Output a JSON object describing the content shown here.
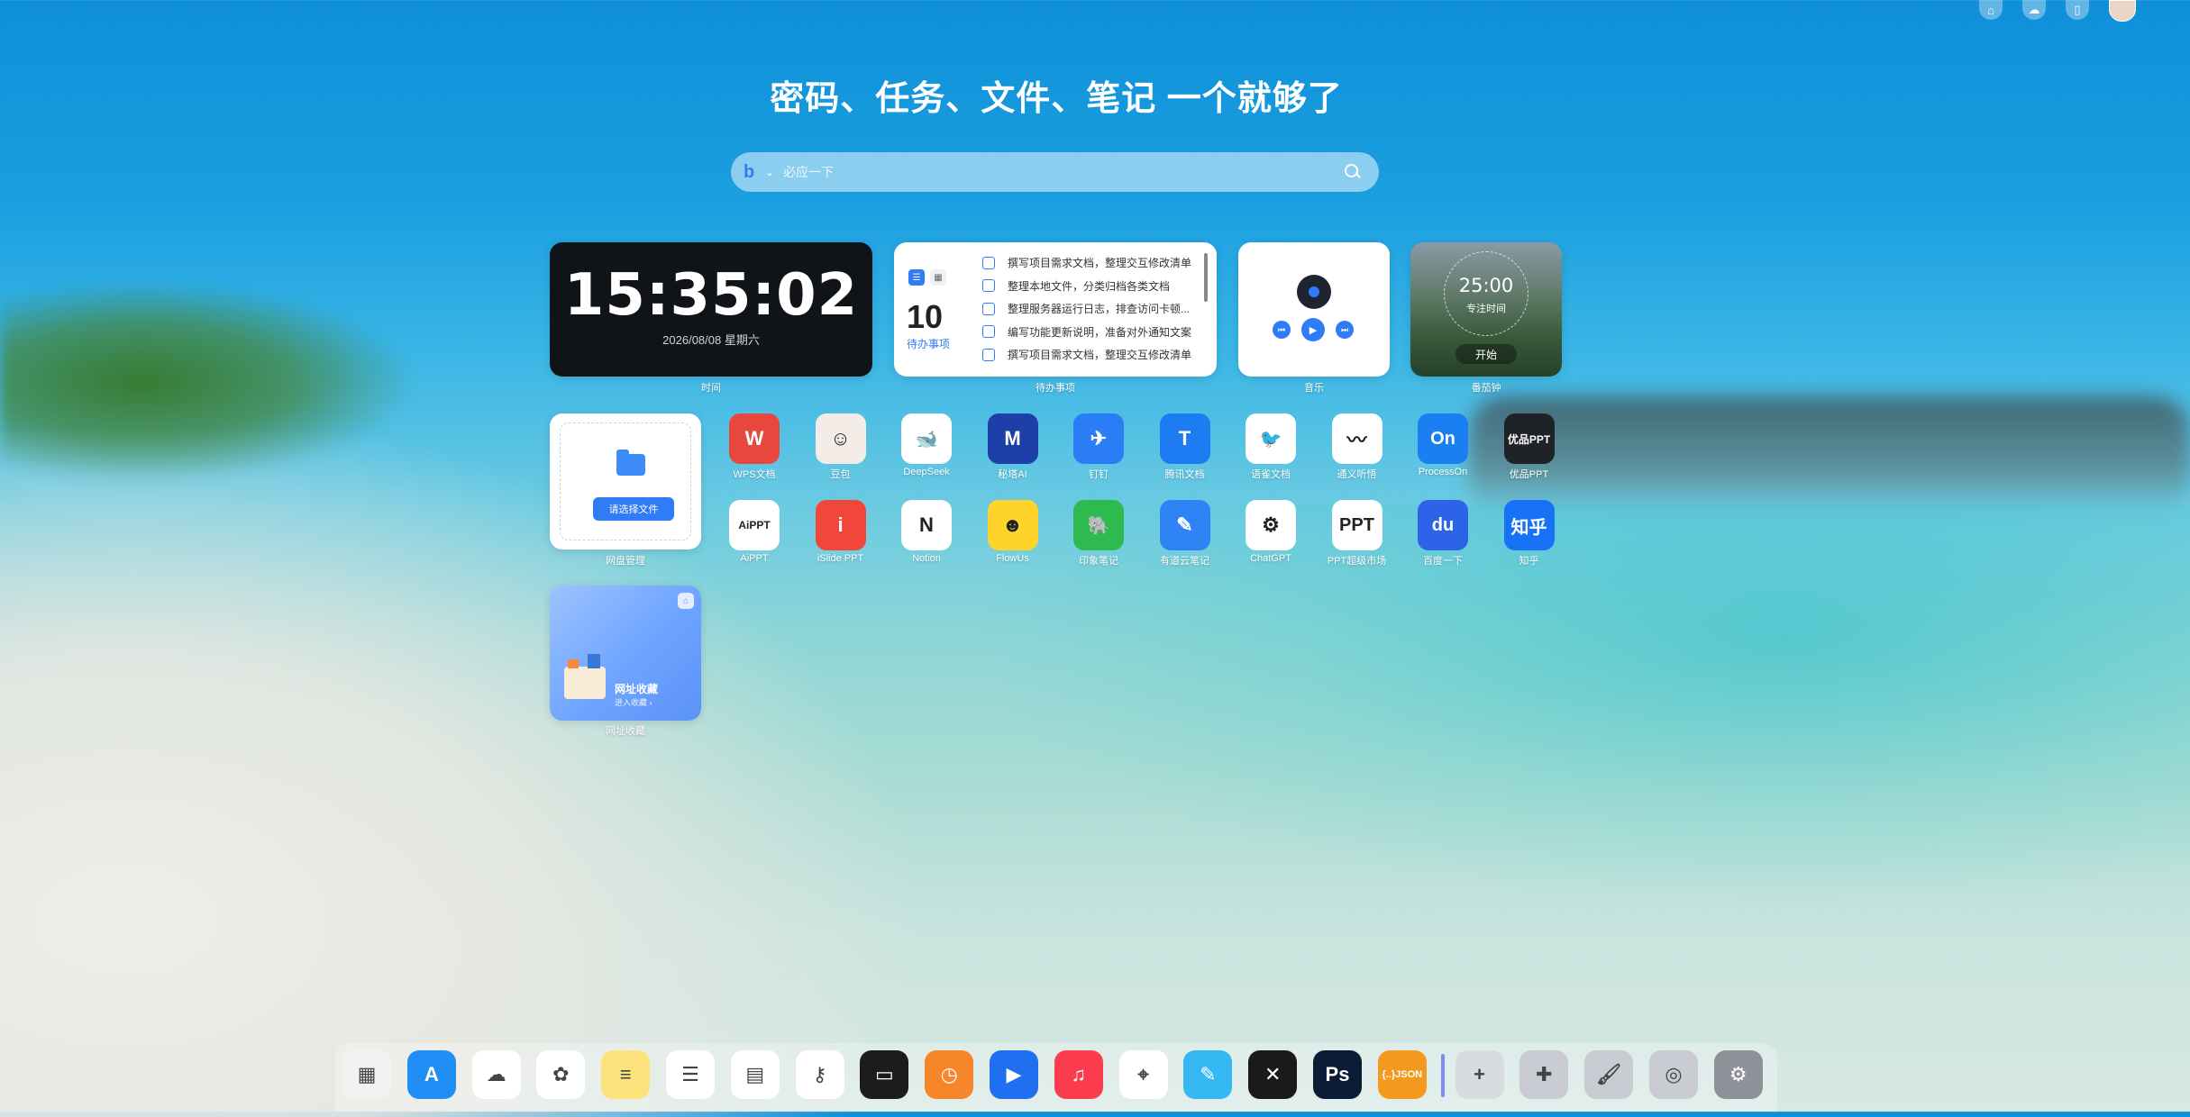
{
  "headline": "密码、任务、文件、笔记 一个就够了",
  "search": {
    "placeholder": "必应一下"
  },
  "clock": {
    "time": "15:35:02",
    "date": "2026/08/08 星期六",
    "caption": "时间"
  },
  "todo": {
    "count": "10",
    "count_label": "待办事项",
    "caption": "待办事项",
    "items": [
      "撰写项目需求文档，整理交互修改清单",
      "整理本地文件，分类归档各类文档",
      "整理服务器运行日志，排查访问卡顿...",
      "编写功能更新说明，准备对外通知文案",
      "撰写项目需求文档，整理交互修改清单"
    ]
  },
  "music": {
    "caption": "音乐"
  },
  "pomodoro": {
    "time": "25:00",
    "label": "专注时间",
    "start": "开始",
    "caption": "番茄钟"
  },
  "disk": {
    "button": "请选择文件",
    "caption": "网盘管理"
  },
  "favorites": {
    "title": "网址收藏",
    "subtitle": "进入收藏 ›",
    "caption": "网址收藏"
  },
  "apps": [
    {
      "label": "WPS文档",
      "glyph": "W",
      "color": "#e8473d",
      "icon": "wps-icon"
    },
    {
      "label": "豆包",
      "glyph": "☺",
      "color": "#f4ece6",
      "icon": "doubao-icon"
    },
    {
      "label": "DeepSeek",
      "glyph": "🐋",
      "color": "#ffffff",
      "icon": "deepseek-icon"
    },
    {
      "label": "秘塔AI",
      "glyph": "M",
      "color": "#1f3fa8",
      "icon": "metaso-icon"
    },
    {
      "label": "钉钉",
      "glyph": "✈",
      "color": "#2a7df4",
      "icon": "dingtalk-icon"
    },
    {
      "label": "腾讯文档",
      "glyph": "T",
      "color": "#1e7cf2",
      "icon": "tencent-docs-icon"
    },
    {
      "label": "语雀文档",
      "glyph": "🐦",
      "color": "#ffffff",
      "icon": "yuque-icon"
    },
    {
      "label": "通义听悟",
      "glyph": "〰",
      "color": "#ffffff",
      "icon": "tongyi-icon"
    },
    {
      "label": "ProcessOn",
      "glyph": "On",
      "color": "#1a7ff0",
      "icon": "processon-icon"
    },
    {
      "label": "优品PPT",
      "glyph": "优品PPT",
      "color": "#1f2226",
      "icon": "youpin-ppt-icon"
    },
    {
      "label": "AiPPT",
      "glyph": "AiPPT",
      "color": "#ffffff",
      "icon": "aippt-icon"
    },
    {
      "label": "iSlide PPT",
      "glyph": "i",
      "color": "#f0473a",
      "icon": "islide-icon"
    },
    {
      "label": "Notion",
      "glyph": "N",
      "color": "#ffffff",
      "icon": "notion-icon"
    },
    {
      "label": "FlowUs",
      "glyph": "☻",
      "color": "#ffd42a",
      "icon": "flowus-icon"
    },
    {
      "label": "印象笔记",
      "glyph": "🐘",
      "color": "#2dba4f",
      "icon": "evernote-icon"
    },
    {
      "label": "有道云笔记",
      "glyph": "✎",
      "color": "#2f84f5",
      "icon": "youdao-note-icon"
    },
    {
      "label": "ChatGPT",
      "glyph": "⚙",
      "color": "#ffffff",
      "icon": "chatgpt-icon"
    },
    {
      "label": "PPT超级市场",
      "glyph": "PPT",
      "color": "#ffffff",
      "icon": "ppt-market-icon"
    },
    {
      "label": "百度一下",
      "glyph": "du",
      "color": "#2d63e8",
      "icon": "baidu-icon"
    },
    {
      "label": "知乎",
      "glyph": "知乎",
      "color": "#1772f6",
      "icon": "zhihu-icon"
    }
  ],
  "dock": [
    {
      "icon": "launchpad-icon",
      "glyph": "▦",
      "color": "#f2f2f2"
    },
    {
      "icon": "app-store-icon",
      "glyph": "A",
      "color": "#1f8ff5"
    },
    {
      "icon": "icloud-icon",
      "glyph": "☁",
      "color": "#ffffff"
    },
    {
      "icon": "photos-icon",
      "glyph": "✿",
      "color": "#ffffff"
    },
    {
      "icon": "notes-icon",
      "glyph": "≡",
      "color": "#fbe27a"
    },
    {
      "icon": "reminders-icon",
      "glyph": "☰",
      "color": "#ffffff"
    },
    {
      "icon": "calendar-icon",
      "glyph": "▤",
      "color": "#ffffff"
    },
    {
      "icon": "passwords-icon",
      "glyph": "⚷",
      "color": "#ffffff"
    },
    {
      "icon": "wallet-icon",
      "glyph": "▭",
      "color": "#1c1c1e"
    },
    {
      "icon": "clock-icon",
      "glyph": "◷",
      "color": "#f7852a"
    },
    {
      "icon": "play-icon",
      "glyph": "▶",
      "color": "#1f6ff0"
    },
    {
      "icon": "music-icon",
      "glyph": "♫",
      "color": "#fb3b4e"
    },
    {
      "icon": "safari-icon",
      "glyph": "⌖",
      "color": "#ffffff"
    },
    {
      "icon": "freeform-icon",
      "glyph": "✎",
      "color": "#35b7f2"
    },
    {
      "icon": "diff-icon",
      "glyph": "✕",
      "color": "#1a1a1a"
    },
    {
      "icon": "photoshop-icon",
      "glyph": "Ps",
      "color": "#0b1b36"
    },
    {
      "icon": "json-icon",
      "glyph": "{..}JSON",
      "color": "#f39a1e"
    },
    {
      "icon": "add-icon",
      "glyph": "+",
      "color": "#d8dbe0"
    },
    {
      "icon": "plugin-icon",
      "glyph": "✚",
      "color": "#c9ccd2"
    },
    {
      "icon": "theme-brush-icon",
      "glyph": "🖌",
      "color": "#c9ccd2"
    },
    {
      "icon": "camera-settings-icon",
      "glyph": "◎",
      "color": "#c9ccd2"
    },
    {
      "icon": "settings-icon",
      "glyph": "⚙",
      "color": "#8e9198"
    }
  ]
}
